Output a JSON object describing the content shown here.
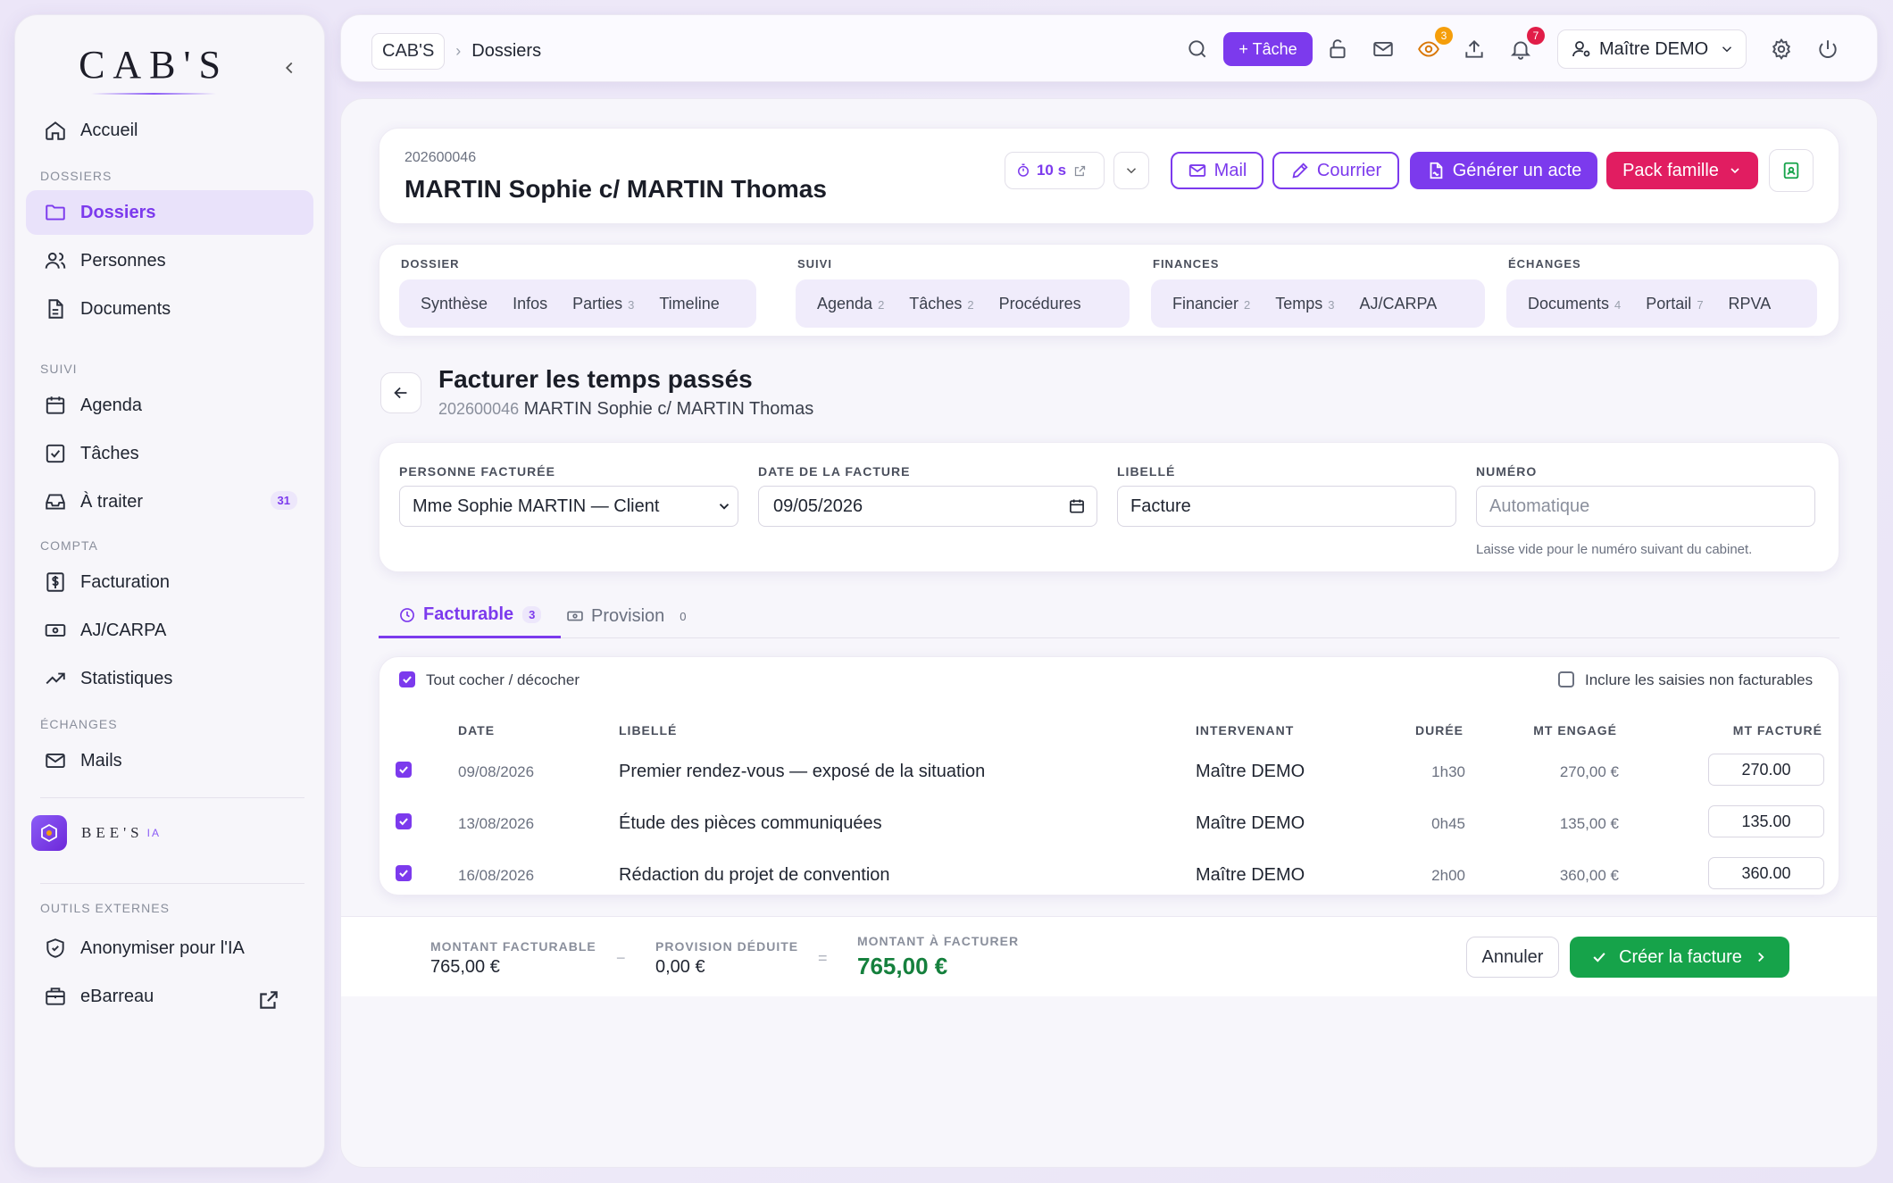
{
  "sidebar": {
    "logo": "CAB'S",
    "collapse_icon": "chevron-left-icon",
    "items": [
      {
        "label": "Accueil",
        "icon": "home-icon"
      },
      {
        "section": "DOSSIERS"
      },
      {
        "label": "Dossiers",
        "icon": "folder-icon",
        "active": true
      },
      {
        "label": "Personnes",
        "icon": "users-icon"
      },
      {
        "label": "Documents",
        "icon": "document-icon"
      },
      {
        "section": "SUIVI"
      },
      {
        "label": "Agenda",
        "icon": "calendar-icon"
      },
      {
        "label": "Tâches",
        "icon": "checkbox-icon"
      },
      {
        "label": "À traiter",
        "icon": "inbox-icon",
        "badge": "31"
      },
      {
        "section": "COMPTA"
      },
      {
        "label": "Facturation",
        "icon": "invoice-icon"
      },
      {
        "label": "AJ/CARPA",
        "icon": "banknote-icon"
      },
      {
        "label": "Statistiques",
        "icon": "trending-up-icon"
      },
      {
        "section": "ÉCHANGES"
      },
      {
        "label": "Mails",
        "icon": "mail-icon"
      }
    ],
    "bees": {
      "name": "BEE'S",
      "suffix": "IA"
    },
    "external_section": "OUTILS EXTERNES",
    "external": [
      {
        "label": "Anonymiser pour l'IA",
        "icon": "shield-icon"
      },
      {
        "label": "eBarreau",
        "icon": "building-icon",
        "ext_icon": "external-link-icon"
      }
    ]
  },
  "topbar": {
    "breadcrumb_home": "CAB'S",
    "breadcrumb_current": "Dossiers",
    "new_task": "+ Tâche",
    "eye_badge": "3",
    "bell_badge": "7",
    "user": "Maître DEMO",
    "accent": "#7c3aed"
  },
  "dossier": {
    "number": "202600046",
    "title": "MARTIN Sophie c/ MARTIN Thomas",
    "timer": "10 s",
    "mail": "Mail",
    "courrier": "Courrier",
    "generate": "Générer un acte",
    "pack": "Pack famille"
  },
  "groups": [
    {
      "label": "DOSSIER",
      "items": [
        {
          "t": "Synthèse"
        },
        {
          "t": "Infos"
        },
        {
          "t": "Parties",
          "c": "3"
        },
        {
          "t": "Timeline"
        }
      ]
    },
    {
      "label": "SUIVI",
      "items": [
        {
          "t": "Agenda",
          "c": "2"
        },
        {
          "t": "Tâches",
          "c": "2"
        },
        {
          "t": "Procédures"
        }
      ]
    },
    {
      "label": "FINANCES",
      "items": [
        {
          "t": "Financier",
          "c": "2"
        },
        {
          "t": "Temps",
          "c": "3"
        },
        {
          "t": "AJ/CARPA"
        }
      ]
    },
    {
      "label": "ÉCHANGES",
      "items": [
        {
          "t": "Documents",
          "c": "4"
        },
        {
          "t": "Portail",
          "c": "7"
        },
        {
          "t": "RPVA"
        }
      ]
    }
  ],
  "page": {
    "title": "Facturer les temps passés",
    "sub_num": "202600046",
    "sub_title": "MARTIN Sophie c/ MARTIN Thomas"
  },
  "form": {
    "person_label": "PERSONNE FACTURÉE",
    "person_value": "Mme Sophie MARTIN — Client",
    "date_label": "DATE DE LA FACTURE",
    "date_value": "09/05/2026",
    "libelle_label": "LIBELLÉ",
    "libelle_value": "Facture",
    "numero_label": "NUMÉRO",
    "numero_placeholder": "Automatique",
    "numero_hint": "Laisse vide pour le numéro suivant du cabinet."
  },
  "tabs": [
    {
      "label": "Facturable",
      "count": "3",
      "active": true
    },
    {
      "label": "Provision",
      "count": "0"
    }
  ],
  "table": {
    "toggle_all": "Tout cocher / décocher",
    "include_nonbill": "Inclure les saisies non facturables",
    "headers": {
      "date": "DATE",
      "libelle": "LIBELLÉ",
      "intervenant": "INTERVENANT",
      "duree": "DURÉE",
      "engage": "MT ENGAGÉ",
      "facture": "MT FACTURÉ"
    },
    "rows": [
      {
        "date": "09/08/2026",
        "libelle": "Premier rendez-vous — exposé de la situation",
        "intervenant": "Maître DEMO",
        "duree": "1h30",
        "engage": "270,00 €",
        "facture": "270.00"
      },
      {
        "date": "13/08/2026",
        "libelle": "Étude des pièces communiquées",
        "intervenant": "Maître DEMO",
        "duree": "0h45",
        "engage": "135,00 €",
        "facture": "135.00"
      },
      {
        "date": "16/08/2026",
        "libelle": "Rédaction du projet de convention",
        "intervenant": "Maître DEMO",
        "duree": "2h00",
        "engage": "360,00 €",
        "facture": "360.00"
      }
    ]
  },
  "footer": {
    "fact_label": "MONTANT FACTURABLE",
    "fact_value": "765,00 €",
    "prov_label": "PROVISION DÉDUITE",
    "prov_value": "0,00 €",
    "total_label": "MONTANT À FACTURER",
    "total_value": "765,00 €",
    "minus": "−",
    "equals": "=",
    "cancel": "Annuler",
    "create": "Créer la facture",
    "success_color": "#16a34a"
  }
}
